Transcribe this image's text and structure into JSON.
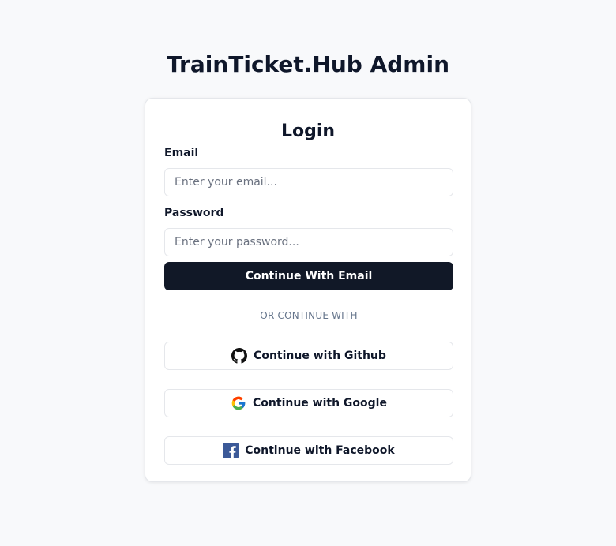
{
  "app": {
    "title": "TrainTicket.Hub Admin"
  },
  "login": {
    "title": "Login",
    "email_label": "Email",
    "email_placeholder": "Enter your email...",
    "email_value": "",
    "password_label": "Password",
    "password_placeholder": "Enter your password...",
    "password_value": "",
    "submit_label": "Continue With Email",
    "divider_text": "OR CONTINUE WITH"
  },
  "social": [
    {
      "label": "Continue with Github",
      "icon": "github-icon"
    },
    {
      "label": "Continue with Google",
      "icon": "google-icon"
    },
    {
      "label": "Continue with Facebook",
      "icon": "facebook-icon"
    }
  ],
  "colors": {
    "background": "#f8f9fb",
    "primary_button": "#111827",
    "facebook_blue": "#3b5998",
    "border": "#e5e7eb"
  }
}
